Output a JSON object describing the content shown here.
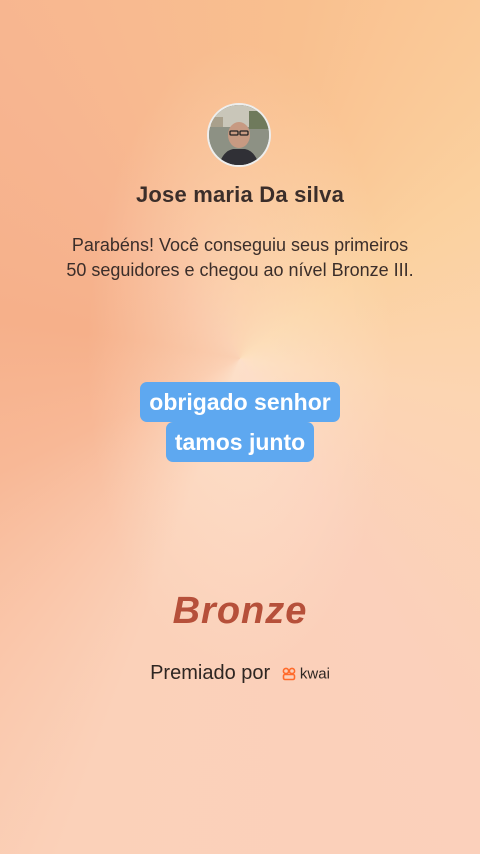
{
  "profile": {
    "name": "Jose maria Da silva",
    "avatar_icon": "user-avatar"
  },
  "achievement": {
    "message": "Parabéns! Você conseguiu seus primeiros 50 seguidores e chegou ao nível Bronze III.",
    "level_badge": "Bronze"
  },
  "caption": {
    "line1": "obrigado senhor",
    "line2": "tamos junto"
  },
  "footer": {
    "awarded_by": "Premiado por",
    "brand": "kwai",
    "brand_icon": "kwai-logo-icon"
  },
  "colors": {
    "caption_bg": "#5ea8f0",
    "bronze_text": "#b6503a",
    "kwai_orange": "#ff6a2a"
  }
}
